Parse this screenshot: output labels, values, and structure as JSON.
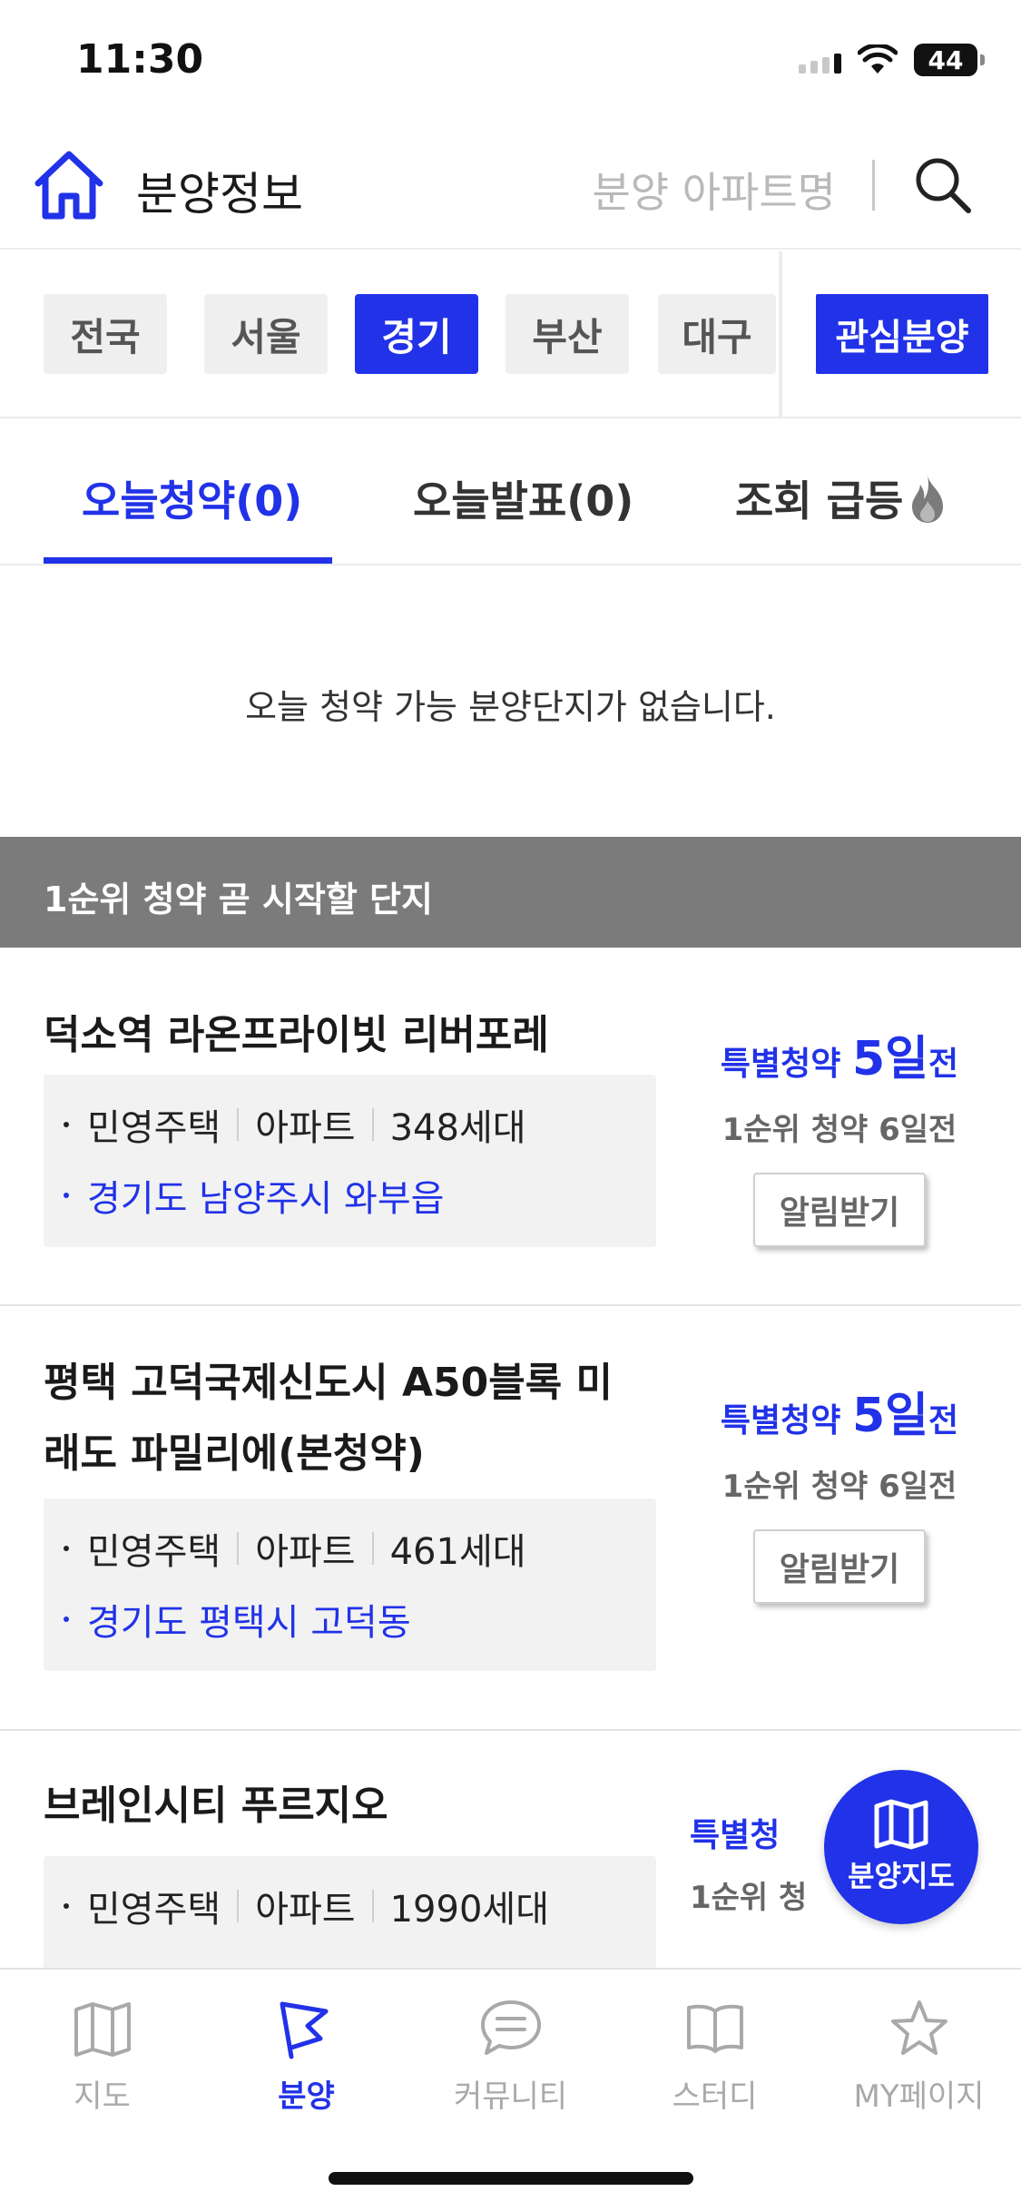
{
  "status_bar": {
    "time": "11:30",
    "battery": "44"
  },
  "header": {
    "title": "분양정보",
    "search_placeholder": "분양 아파트명"
  },
  "regions": {
    "items": [
      {
        "label": "전국",
        "active": false
      },
      {
        "label": "서울",
        "active": false
      },
      {
        "label": "경기",
        "active": true
      },
      {
        "label": "부산",
        "active": false
      },
      {
        "label": "대구",
        "active": false
      }
    ],
    "favorites_label": "관심분양"
  },
  "tabs": [
    {
      "label": "오늘청약(0)",
      "active": true
    },
    {
      "label": "오늘발표(0)",
      "active": false
    },
    {
      "label": "조회 급등",
      "active": false,
      "icon": "flame-icon"
    }
  ],
  "empty_message": "오늘 청약 가능 분양단지가 없습니다.",
  "section_title": "1순위 청약 곧 시작할 단지",
  "listings": [
    {
      "name": "덕소역 라온프라이빗 리버포레",
      "supply_type": "민영주택",
      "house_type": "아파트",
      "units": "348세대",
      "address": "경기도 남양주시 와부읍",
      "special_prefix": "특별청약",
      "special_days": "5일",
      "special_suffix": "전",
      "rank1": "1순위 청약 6일전",
      "notify_label": "알림받기"
    },
    {
      "name": "평택 고덕국제신도시 A50블록 미래도 파밀리에(본청약)",
      "supply_type": "민영주택",
      "house_type": "아파트",
      "units": "461세대",
      "address": "경기도 평택시 고덕동",
      "special_prefix": "특별청약",
      "special_days": "5일",
      "special_suffix": "전",
      "rank1": "1순위 청약 6일전",
      "notify_label": "알림받기"
    },
    {
      "name": "브레인시티 푸르지오",
      "supply_type": "민영주택",
      "house_type": "아파트",
      "units": "1990세대",
      "special_prefix": "특별청",
      "rank1": "1순위 청"
    }
  ],
  "fab": {
    "label": "분양지도",
    "icon": "map-icon"
  },
  "bottom_nav": [
    {
      "label": "지도",
      "icon": "map-icon",
      "active": false
    },
    {
      "label": "분양",
      "icon": "flag-icon",
      "active": true
    },
    {
      "label": "커뮤니티",
      "icon": "chat-bubble-icon",
      "active": false
    },
    {
      "label": "스터디",
      "icon": "book-icon",
      "active": false
    },
    {
      "label": "MY페이지",
      "icon": "star-icon",
      "active": false
    }
  ]
}
